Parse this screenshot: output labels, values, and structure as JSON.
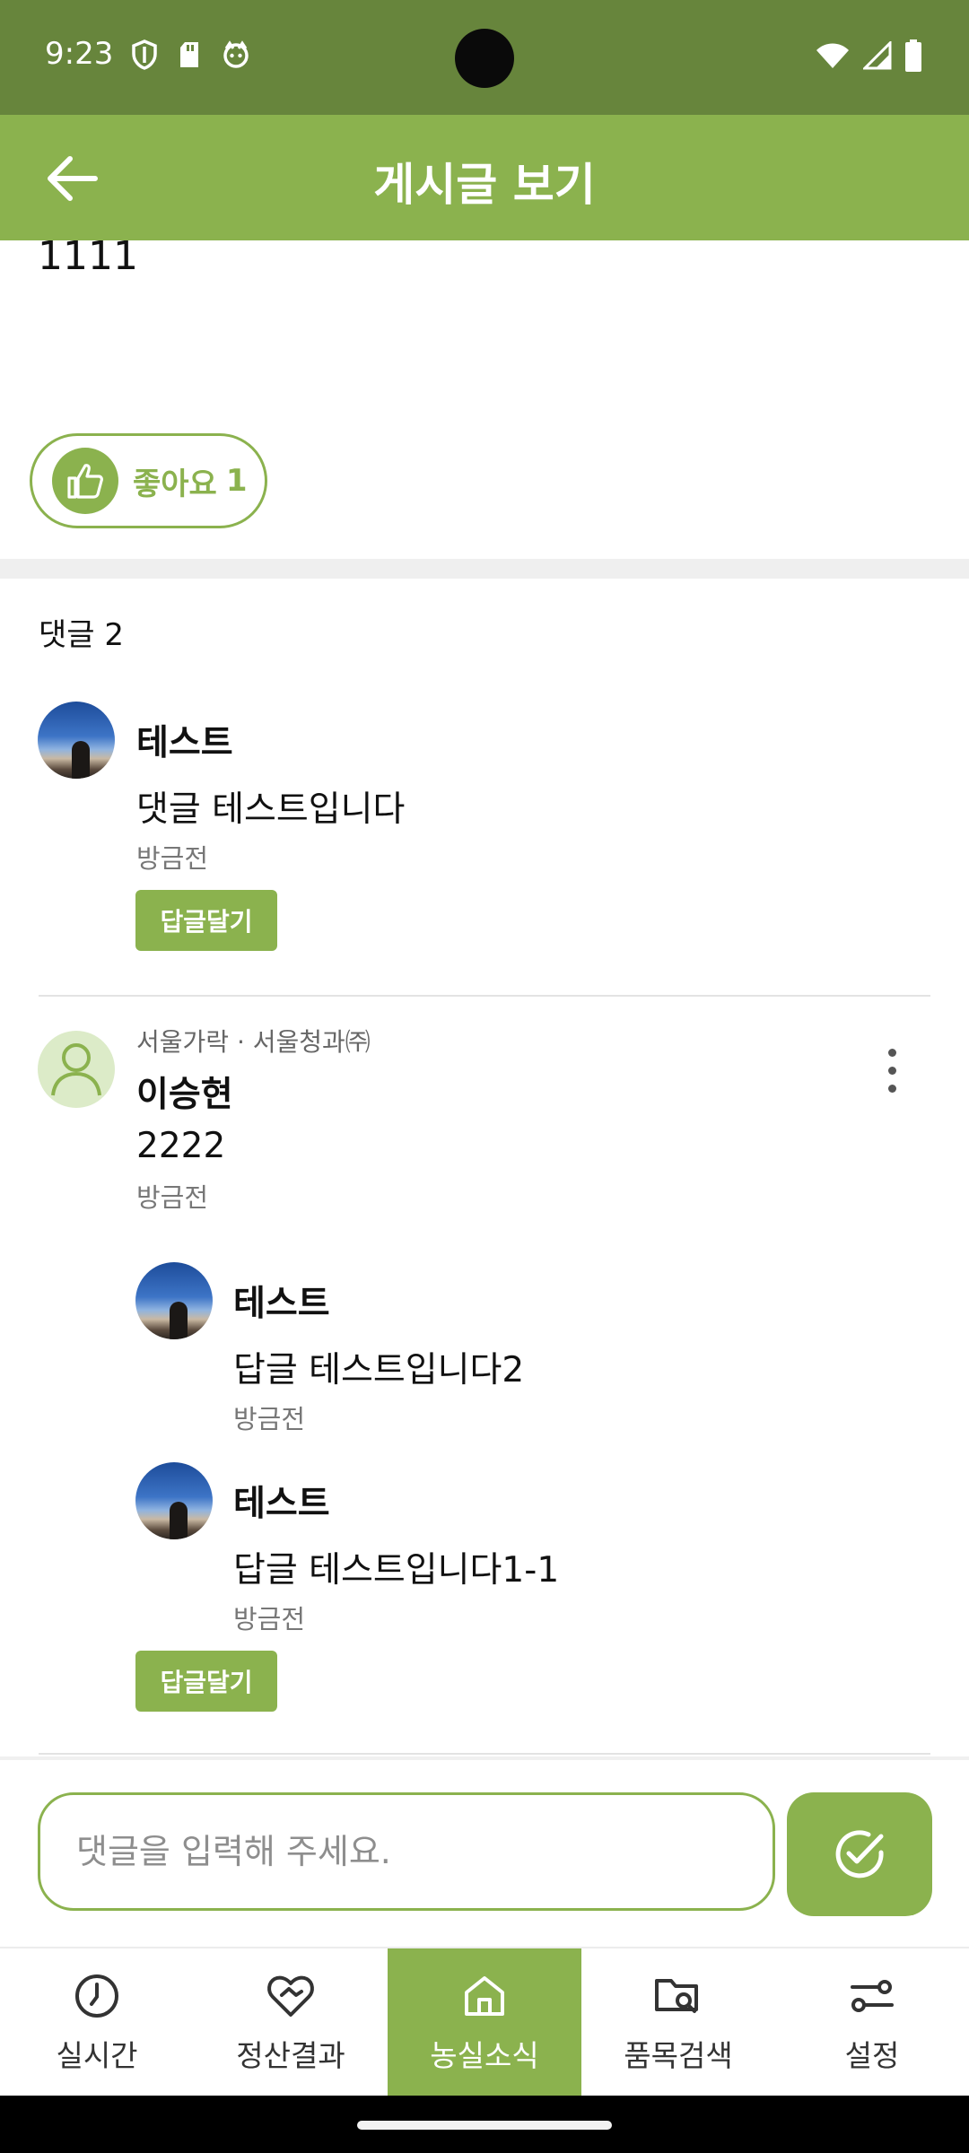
{
  "status_bar": {
    "time": "9:23",
    "left_icons": [
      "shield-icon",
      "sd-card-icon",
      "face-icon"
    ],
    "right_icons": [
      "wifi-icon",
      "signal-icon",
      "battery-icon"
    ]
  },
  "app_bar": {
    "title": "게시글 보기",
    "back_icon": "arrow-left-icon"
  },
  "post": {
    "body": "1111",
    "like_label": "좋아요",
    "like_count": "1"
  },
  "comments_header": "댓글 2",
  "comments": [
    {
      "author": "테스트",
      "text": "댓글 테스트입니다",
      "time": "방금전",
      "reply_label": "답글달기"
    },
    {
      "meta": "서울가락 · 서울청과㈜",
      "author": "이승현",
      "text": "2222",
      "time": "방금전",
      "replies": [
        {
          "author": "테스트",
          "text": "답글 테스트입니다2",
          "time": "방금전"
        },
        {
          "author": "테스트",
          "text": "답글 테스트입니다1-1",
          "time": "방금전"
        }
      ],
      "reply_label": "답글달기"
    }
  ],
  "comment_input": {
    "placeholder": "댓글을 입력해 주세요.",
    "value": ""
  },
  "bottom_nav": [
    {
      "label": "실시간",
      "icon": "clock-icon",
      "active": false
    },
    {
      "label": "정산결과",
      "icon": "handshake-heart-icon",
      "active": false
    },
    {
      "label": "농실소식",
      "icon": "home-icon",
      "active": true
    },
    {
      "label": "품목검색",
      "icon": "folder-search-icon",
      "active": false
    },
    {
      "label": "설정",
      "icon": "sliders-icon",
      "active": false
    }
  ],
  "colors": {
    "status_bar": "#67853c",
    "primary": "#8bb24e",
    "divider": "#efefef"
  }
}
